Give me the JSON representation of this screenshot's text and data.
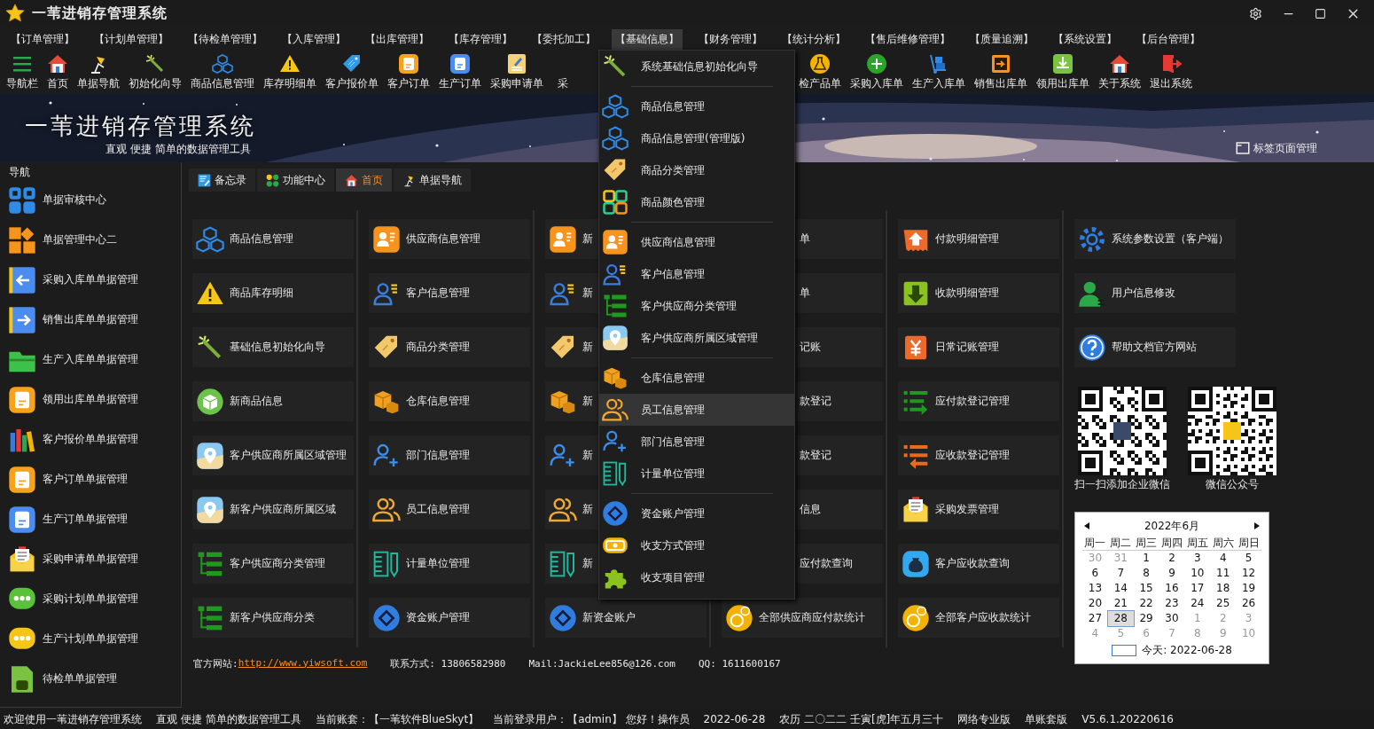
{
  "window": {
    "title": "一苇进销存管理系统"
  },
  "menu": [
    {
      "label": "【订单管理】",
      "selected": false
    },
    {
      "label": "【计划单管理】",
      "selected": false
    },
    {
      "label": "【待检单管理】",
      "selected": false
    },
    {
      "label": "【入库管理】",
      "selected": false
    },
    {
      "label": "【出库管理】",
      "selected": false
    },
    {
      "label": "【库存管理】",
      "selected": false
    },
    {
      "label": "【委托加工】",
      "selected": false
    },
    {
      "label": "【基础信息】",
      "selected": true
    },
    {
      "label": "【财务管理】",
      "selected": false
    },
    {
      "label": "【统计分析】",
      "selected": false
    },
    {
      "label": "【售后维修管理】",
      "selected": false
    },
    {
      "label": "【质量追溯】",
      "selected": false
    },
    {
      "label": "【系统设置】",
      "selected": false
    },
    {
      "label": "【后台管理】",
      "selected": false
    }
  ],
  "toolbar": {
    "left": [
      "导航栏",
      "首页",
      "单据导航",
      "初始化向导",
      "商品信息管理",
      "库存明细单",
      "客户报价单",
      "客户订单",
      "生产订单",
      "采购申请单",
      "采"
    ],
    "right": [
      "检产品单",
      "采购入库单",
      "生产入库单",
      "销售出库单",
      "领用出库单",
      "关于系统",
      "退出系统"
    ]
  },
  "banner": {
    "title": "一苇进销存管理系统",
    "subtitle": "直观 便捷 简单的数据管理工具",
    "tab_manager": "标签页面管理"
  },
  "sidebar": {
    "title": "导航",
    "items": [
      "单据审核中心",
      "单据管理中心二",
      "采购入库单单据管理",
      "销售出库单单据管理",
      "生产入库单单据管理",
      "领用出库单单据管理",
      "客户报价单单据管理",
      "客户订单单据管理",
      "生产订单单据管理",
      "采购申请单单据管理",
      "采购计划单单据管理",
      "生产计划单单据管理",
      "待检单单据管理"
    ]
  },
  "tabs": [
    {
      "label": "备忘录",
      "selected": false
    },
    {
      "label": "功能中心",
      "selected": false
    },
    {
      "label": "首页",
      "selected": true
    },
    {
      "label": "单据导航",
      "selected": false
    }
  ],
  "grid": {
    "columns": [
      [
        "商品信息管理",
        "商品库存明细",
        "基础信息初始化向导",
        "新商品信息",
        "客户供应商所属区域管理",
        "新客户供应商所属区域",
        "客户供应商分类管理",
        "新客户供应商分类"
      ],
      [
        "供应商信息管理",
        "客户信息管理",
        "商品分类管理",
        "仓库信息管理",
        "部门信息管理",
        "员工信息管理",
        "计量单位管理",
        "资金账户管理"
      ],
      [
        "新",
        "新",
        "新",
        "新",
        "新",
        "新",
        "新",
        "新资金账户"
      ],
      [
        "单",
        "单",
        "记账",
        "款登记",
        "款登记",
        "信息",
        "应付款查询",
        "全部供应商应付款统计"
      ],
      [
        "付款明细管理",
        "收款明细管理",
        "日常记账管理",
        "应付款登记管理",
        "应收款登记管理",
        "采购发票管理",
        "客户应收款查询",
        "全部客户应收款统计"
      ],
      [
        "系统参数设置（客户端）",
        "用户信息修改",
        "帮助文档官方网站"
      ]
    ]
  },
  "qr_codes": [
    {
      "caption": "扫一扫添加企业微信"
    },
    {
      "caption": "微信公众号"
    }
  ],
  "calendar": {
    "month": "2022年6月",
    "weekdays": [
      "周一",
      "周二",
      "周三",
      "周四",
      "周五",
      "周六",
      "周日"
    ],
    "days": [
      {
        "label": "30",
        "other_month": true,
        "selected": false
      },
      {
        "label": "31",
        "other_month": true,
        "selected": false
      },
      {
        "label": "1",
        "other_month": false,
        "selected": false
      },
      {
        "label": "2",
        "other_month": false,
        "selected": false
      },
      {
        "label": "3",
        "other_month": false,
        "selected": false
      },
      {
        "label": "4",
        "other_month": false,
        "selected": false
      },
      {
        "label": "5",
        "other_month": false,
        "selected": false
      },
      {
        "label": "6",
        "other_month": false,
        "selected": false
      },
      {
        "label": "7",
        "other_month": false,
        "selected": false
      },
      {
        "label": "8",
        "other_month": false,
        "selected": false
      },
      {
        "label": "9",
        "other_month": false,
        "selected": false
      },
      {
        "label": "10",
        "other_month": false,
        "selected": false
      },
      {
        "label": "11",
        "other_month": false,
        "selected": false
      },
      {
        "label": "12",
        "other_month": false,
        "selected": false
      },
      {
        "label": "13",
        "other_month": false,
        "selected": false
      },
      {
        "label": "14",
        "other_month": false,
        "selected": false
      },
      {
        "label": "15",
        "other_month": false,
        "selected": false
      },
      {
        "label": "16",
        "other_month": false,
        "selected": false
      },
      {
        "label": "17",
        "other_month": false,
        "selected": false
      },
      {
        "label": "18",
        "other_month": false,
        "selected": false
      },
      {
        "label": "19",
        "other_month": false,
        "selected": false
      },
      {
        "label": "20",
        "other_month": false,
        "selected": false
      },
      {
        "label": "21",
        "other_month": false,
        "selected": false
      },
      {
        "label": "22",
        "other_month": false,
        "selected": false
      },
      {
        "label": "23",
        "other_month": false,
        "selected": false
      },
      {
        "label": "24",
        "other_month": false,
        "selected": false
      },
      {
        "label": "25",
        "other_month": false,
        "selected": false
      },
      {
        "label": "26",
        "other_month": false,
        "selected": false
      },
      {
        "label": "27",
        "other_month": false,
        "selected": false
      },
      {
        "label": "28",
        "other_month": false,
        "selected": true
      },
      {
        "label": "29",
        "other_month": false,
        "selected": false
      },
      {
        "label": "30",
        "other_month": false,
        "selected": false
      },
      {
        "label": "1",
        "other_month": true,
        "selected": false
      },
      {
        "label": "2",
        "other_month": true,
        "selected": false
      },
      {
        "label": "3",
        "other_month": true,
        "selected": false
      },
      {
        "label": "4",
        "other_month": true,
        "selected": false
      },
      {
        "label": "5",
        "other_month": true,
        "selected": false
      },
      {
        "label": "6",
        "other_month": true,
        "selected": false
      },
      {
        "label": "7",
        "other_month": true,
        "selected": false
      },
      {
        "label": "8",
        "other_month": true,
        "selected": false
      },
      {
        "label": "9",
        "other_month": true,
        "selected": false
      },
      {
        "label": "10",
        "other_month": true,
        "selected": false
      }
    ],
    "today": "今天: 2022-06-28"
  },
  "footer": {
    "website_label": "官方网站:",
    "website": "http://www.yiwsoft.com",
    "contact": "联系方式: 13806582980",
    "mail": "Mail:JackieLee856@126.com",
    "qq": "QQ: 1611600167"
  },
  "dropdown": {
    "groups": [
      [
        {
          "label": "系统基础信息初始化向导",
          "highlighted": false
        }
      ],
      [
        {
          "label": "商品信息管理",
          "highlighted": false
        },
        {
          "label": "商品信息管理(管理版)",
          "highlighted": false
        },
        {
          "label": "商品分类管理",
          "highlighted": false
        },
        {
          "label": "商品颜色管理",
          "highlighted": false
        }
      ],
      [
        {
          "label": "供应商信息管理",
          "highlighted": false
        },
        {
          "label": "客户信息管理",
          "highlighted": false
        },
        {
          "label": "客户供应商分类管理",
          "highlighted": false
        },
        {
          "label": "客户供应商所属区域管理",
          "highlighted": false
        }
      ],
      [
        {
          "label": "仓库信息管理",
          "highlighted": false
        },
        {
          "label": "员工信息管理",
          "highlighted": true
        },
        {
          "label": "部门信息管理",
          "highlighted": false
        },
        {
          "label": "计量单位管理",
          "highlighted": false
        }
      ],
      [
        {
          "label": "资金账户管理",
          "highlighted": false
        },
        {
          "label": "收支方式管理",
          "highlighted": false
        },
        {
          "label": "收支项目管理",
          "highlighted": false
        }
      ]
    ]
  },
  "status_bar": [
    "欢迎使用一苇进销存管理系统",
    "直观 便捷 简单的数据管理工具",
    "当前账套：【一苇软件BlueSkyt】",
    "当前登录用户：【admin】 您好！操作员",
    "2022-06-28",
    "农历 二〇二二 壬寅[虎]年五月三十",
    "网络专业版",
    "单账套版",
    "V5.6.1.20220616"
  ]
}
